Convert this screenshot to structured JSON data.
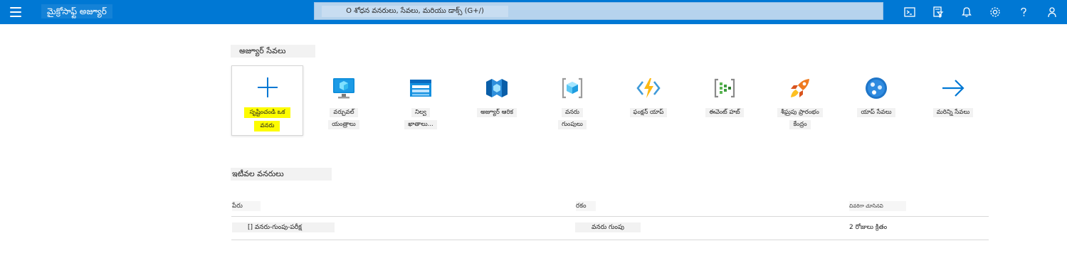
{
  "header": {
    "brand": "మైక్రోసాఫ్ట్ అజ్యూర్",
    "search_placeholder": "O శోధన వనరులు, సేవలు, మరియు డాక్స్ (G+/)"
  },
  "topbar_icons": [
    "cloud-shell-icon",
    "directory-filter-icon",
    "notifications-bell-icon",
    "settings-gear-icon",
    "help-question-icon",
    "feedback-person-icon"
  ],
  "services": {
    "title": "అజ్యూర్ సేవలు",
    "tiles": [
      {
        "name": "create-resource",
        "icon": "plus-icon",
        "lines": [
          "సృష్టించండి ఒక",
          "వనరు"
        ]
      },
      {
        "name": "virtual-machines",
        "icon": "virtual-machine-icon",
        "lines": [
          "వర్చువల్",
          "యంత్రాలు"
        ]
      },
      {
        "name": "storage-accounts",
        "icon": "storage-account-icon",
        "lines": [
          "నిల్వ",
          "ఖాతాలు..."
        ]
      },
      {
        "name": "azure-ad",
        "icon": "active-directory-icon",
        "lines": [
          "అజ్యూర్ ఆరిక"
        ]
      },
      {
        "name": "resource-groups",
        "icon": "resource-group-icon",
        "lines": [
          "వనరు",
          "గుంపులు"
        ]
      },
      {
        "name": "function-app",
        "icon": "function-app-icon",
        "lines": [
          "ఫంక్షన్ యాప్"
        ]
      },
      {
        "name": "event-hubs",
        "icon": "event-hubs-icon",
        "lines": [
          "ఈవెంట్ హబ్"
        ]
      },
      {
        "name": "quickstart-center",
        "icon": "rocket-icon",
        "lines": [
          "శీఘ్రపు ప్రారంభం",
          "కేంద్రం"
        ]
      },
      {
        "name": "app-services",
        "icon": "app-service-icon",
        "lines": [
          "యాప్ సేవలు"
        ]
      },
      {
        "name": "more-services",
        "icon": "arrow-right-icon",
        "lines": [
          "మరిన్ని సేవలు"
        ]
      }
    ]
  },
  "recent": {
    "title": "ఇటీవల వనరులు",
    "columns": [
      "పేరు",
      "రకం",
      "చివరిగా చూసినవి"
    ],
    "rows": [
      {
        "name": "[] వనరు-గుంపు-పరీక్ష",
        "type": "వనరు గుంపు",
        "viewed": "2 రోజులు క్రితం"
      }
    ]
  },
  "colors": {
    "topbar": "#0078d4",
    "search": "#b6d3ed",
    "highlight": "#fdfc00",
    "label_bg": "#f2f2f2"
  }
}
